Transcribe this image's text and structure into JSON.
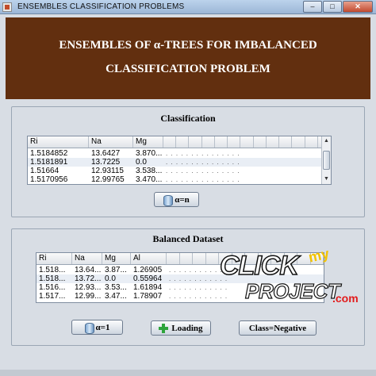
{
  "window": {
    "title": "ENSEMBLES CLASSIFICATION PROBLEMS",
    "minimize_symbol": "–",
    "maximize_symbol": "□",
    "close_symbol": "✕"
  },
  "banner": {
    "line1": "ENSEMBLES OF α-TREES FOR IMBALANCED",
    "line2": "CLASSIFICATION PROBLEM"
  },
  "classification": {
    "title": "Classification",
    "columns": [
      "Ri",
      "Na",
      "Mg"
    ],
    "rows": [
      [
        "1.5184852",
        "13.6427",
        "3.870..."
      ],
      [
        "1.5181891",
        "13.7225",
        "0.0"
      ],
      [
        "1.51664",
        "12.93115",
        "3.538..."
      ],
      [
        "1.5170956",
        "12.99765",
        "3.470..."
      ]
    ],
    "truncated_cells": ". . .   . . .   . . .   . . .   . . .",
    "button_label": "α=n"
  },
  "balanced": {
    "title": "Balanced Dataset",
    "columns": [
      "Ri",
      "Na",
      "Mg",
      "Al"
    ],
    "rows": [
      [
        "1.518...",
        "13.64...",
        "3.87...",
        "1.26905"
      ],
      [
        "1.518...",
        "13.72...",
        "0.0",
        "0.55964"
      ],
      [
        "1.516...",
        "12.93...",
        "3.53...",
        "1.61894"
      ],
      [
        "1.517...",
        "12.99...",
        "3.47...",
        "1.78907"
      ]
    ],
    "truncated_cells": ". . .   . . .   . . .   . . .",
    "buttons": {
      "alpha": "α=1",
      "loading": "Loading",
      "class": "Class=Negative"
    }
  },
  "watermark": {
    "click": "CLICK",
    "my": "my",
    "project": "PROJECT",
    "com": ".com"
  },
  "colors": {
    "banner": "#622f0f",
    "panel": "#d8dde4",
    "loading_icon": "#2ea43c"
  },
  "icons": {
    "database": "database-icon",
    "plus": "plus-icon"
  }
}
